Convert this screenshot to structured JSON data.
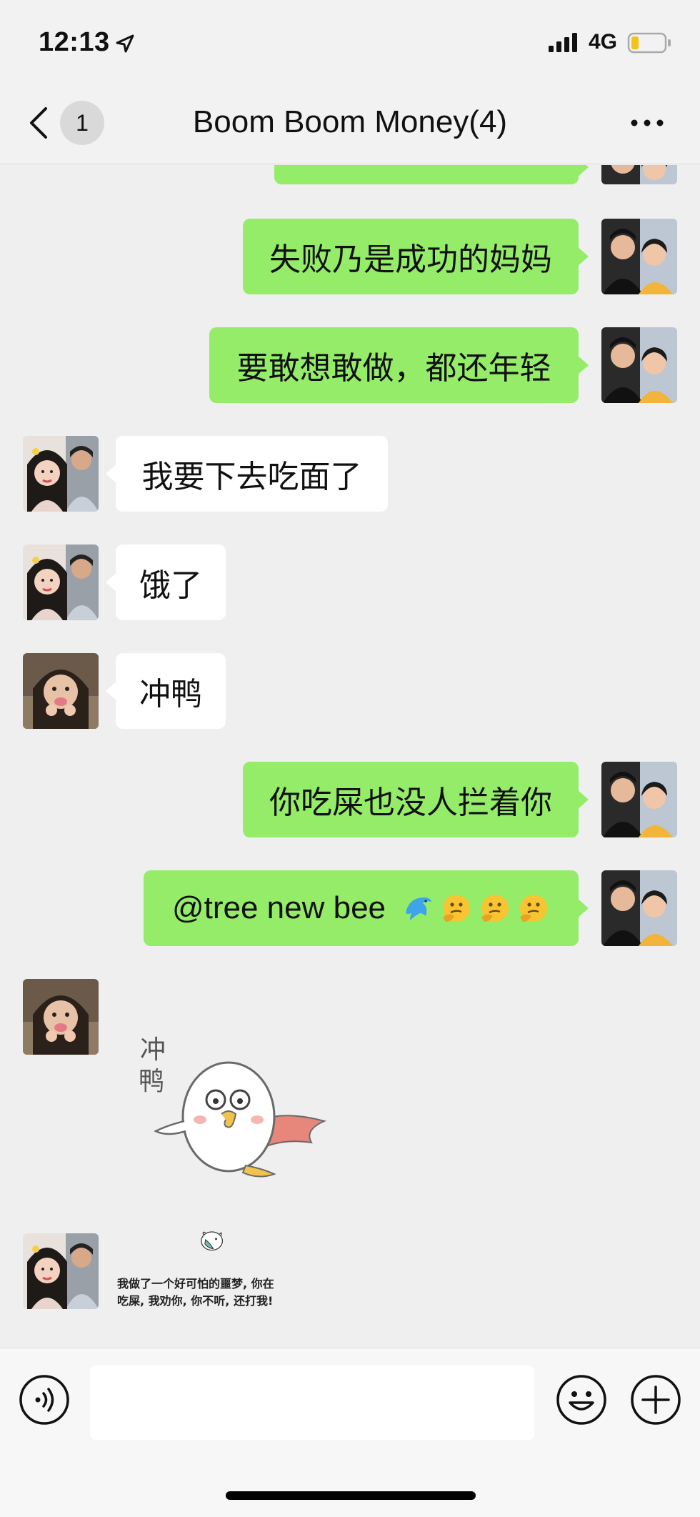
{
  "status_bar": {
    "time": "12:13",
    "network": "4G",
    "location_icon": "location-arrow-icon",
    "signal_icon": "signal-bars-icon",
    "battery_icon": "battery-low-icon"
  },
  "header": {
    "back_icon": "chevron-left-icon",
    "unread_count": "1",
    "title": "Boom Boom Money(4)",
    "more_icon": "more-dots-icon"
  },
  "colors": {
    "outgoing_bubble": "#95ec69",
    "incoming_bubble": "#ffffff",
    "background": "#efefef"
  },
  "messages": [
    {
      "side": "me",
      "text": "失败乃是成功的妈妈"
    },
    {
      "side": "me",
      "text": "要敢想敢做，都还年轻"
    },
    {
      "side": "them",
      "text": "我要下去吃面了"
    },
    {
      "side": "them",
      "text": "饿了"
    },
    {
      "side": "them",
      "text": "冲鸭"
    },
    {
      "side": "me",
      "text": "你吃屎也没人拦着你"
    },
    {
      "side": "me",
      "text": "@tree new bee",
      "emojis": [
        "dolphin-emoji",
        "thinking-face-emoji",
        "thinking-face-emoji",
        "thinking-face-emoji"
      ]
    }
  ],
  "stickers": [
    {
      "name": "duck-sticker",
      "text": "冲鸭"
    },
    {
      "name": "meme-sticker",
      "text_line1": "我做了一个好可怕的噩梦, 你在",
      "text_line2": "吃屎, 我劝你, 你不听, 还打我!"
    }
  ],
  "input_bar": {
    "voice_icon": "voice-icon",
    "emoji_icon": "smiley-icon",
    "plus_icon": "plus-circle-icon",
    "input_value": ""
  }
}
